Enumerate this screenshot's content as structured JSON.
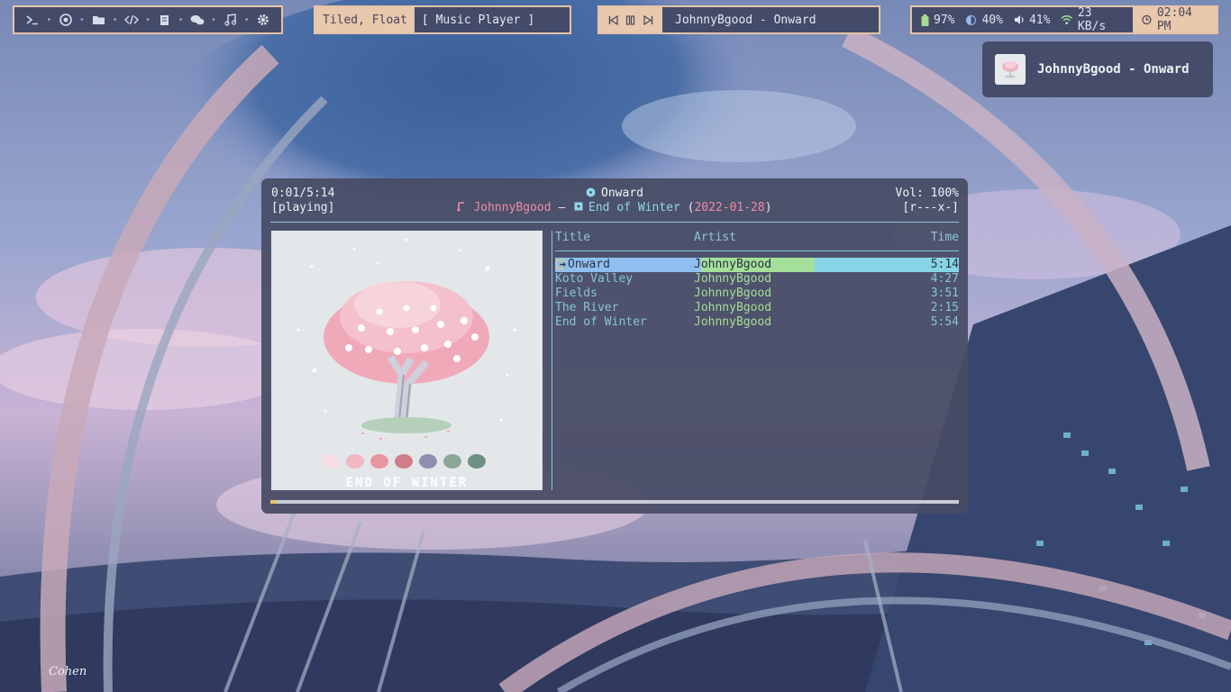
{
  "colors": {
    "bar_border": "#e5c3a8",
    "bar_bg": "#444b68",
    "accent_peach": "#e8c9ae",
    "player_bg": "#474b64",
    "artist_pink": "#f08aa6",
    "album_cyan": "#8fd6ea",
    "artist_green": "#a6dc94"
  },
  "launcher": {
    "icons": [
      "terminal-icon",
      "chrome-icon",
      "folder-icon",
      "code-icon",
      "notes-icon",
      "chat-icon",
      "music-icon",
      "settings-icon"
    ]
  },
  "layout": {
    "mode": "Tiled, Float",
    "window_title": "[ Music Player ]"
  },
  "media": {
    "controls": [
      "previous-icon",
      "pause-icon",
      "next-icon"
    ],
    "now_playing": "JohnnyBgood - Onward"
  },
  "status": {
    "battery": "97%",
    "brightness": "40%",
    "volume": "41%",
    "network": "23 KB/s",
    "clock": "02:04 PM"
  },
  "notification": {
    "text": "JohnnyBgood - Onward"
  },
  "player": {
    "elapsed": "0:01/5:14",
    "state": "[playing]",
    "title": "Onward",
    "artist": "JohnnyBgood",
    "separator": "–",
    "album": "End of Winter",
    "date": "2022-01-28",
    "volume": "Vol: 100%",
    "flags": "[r---x-]",
    "progress": 0.003,
    "art_caption": "END OF WINTER"
  },
  "playlist": {
    "columns": {
      "title": "Title",
      "artist": "Artist",
      "time": "Time"
    },
    "rows": [
      {
        "title": "Onward",
        "artist": "JohnnyBgood",
        "time": "5:14"
      },
      {
        "title": "Koto Valley",
        "artist": "JohnnyBgood",
        "time": "4:27"
      },
      {
        "title": "Fields",
        "artist": "JohnnyBgood",
        "time": "3:51"
      },
      {
        "title": "The River",
        "artist": "JohnnyBgood",
        "time": "2:15"
      },
      {
        "title": "End of Winter",
        "artist": "JohnnyBgood",
        "time": "5:54"
      }
    ],
    "current_index": 0
  },
  "wallpaper": {
    "signature": "Cohen"
  }
}
